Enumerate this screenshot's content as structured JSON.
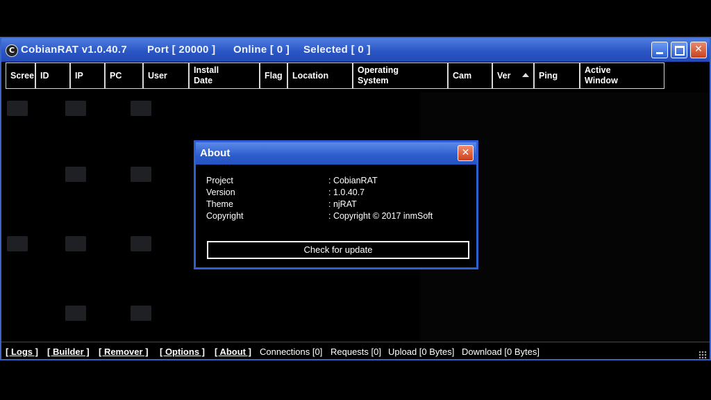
{
  "window": {
    "title_app": "CobianRAT v1.0.40.7",
    "title_port": "Port [ 20000 ]",
    "title_online": "Online [ 0 ]",
    "title_selected": "Selected [ 0 ]",
    "app_icon": "C",
    "minimize_icon": "minimize-icon",
    "maximize_icon": "maximize-icon",
    "close_icon": "close-icon"
  },
  "columns": [
    {
      "label": "Scree"
    },
    {
      "label": "ID"
    },
    {
      "label": "IP"
    },
    {
      "label": "PC"
    },
    {
      "label": "User"
    },
    {
      "label": "Install\nDate"
    },
    {
      "label": "Flag"
    },
    {
      "label": "Location"
    },
    {
      "label": "Operating\nSystem"
    },
    {
      "label": "Cam"
    },
    {
      "label": "Ver"
    },
    {
      "label": "Ping"
    },
    {
      "label": "Active\nWindow"
    }
  ],
  "about": {
    "title": "About",
    "rows": [
      {
        "key": "Project",
        "value": ": CobianRAT"
      },
      {
        "key": "Version",
        "value": ": 1.0.40.7"
      },
      {
        "key": "Theme",
        "value": ": njRAT"
      },
      {
        "key": "Copyright",
        "value": ": Copyright © 2017 inmSoft"
      }
    ],
    "button": "Check for update"
  },
  "statusbar": {
    "logs": "[ Logs ]",
    "builder": "[ Builder ]",
    "remover": "[ Remover ]",
    "options": "[ Options ]",
    "about": "[ About ]",
    "connections": "Connections [0]",
    "requests": "Requests [0]",
    "upload": "Upload [0 Bytes]",
    "download": "Download [0 Bytes]"
  },
  "colors": {
    "titlebar": "#2b56c6",
    "close_button": "#c7431f",
    "background": "#000000",
    "text": "#ffffff"
  }
}
